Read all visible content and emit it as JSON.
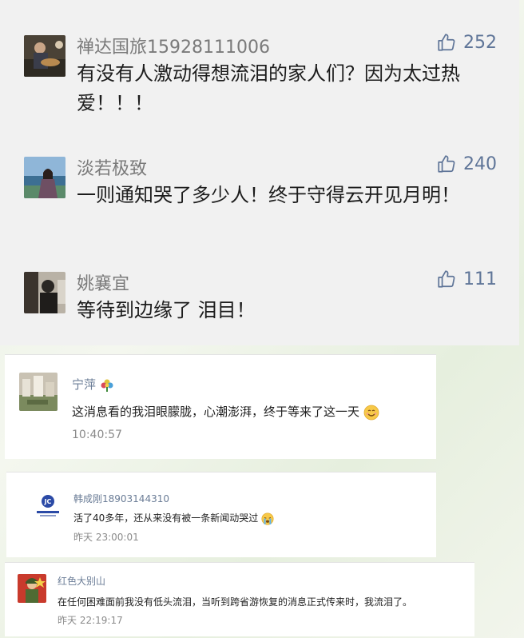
{
  "comments": [
    {
      "user": "禅达国旅15928111006",
      "likes": "252",
      "text": "有没有人激动得想流泪的家人们？因为太过热爱！！！",
      "avatar": "guitar-player-photo"
    },
    {
      "user": "淡若极致",
      "likes": "240",
      "text": "一则通知哭了多少人！终于守得云开见月明！",
      "avatar": "lakeside-woman-photo"
    },
    {
      "user": "姚襄宜",
      "likes": "111",
      "text": "等待到边缘了 泪目！",
      "avatar": "silhouette-photo"
    }
  ],
  "posts": [
    {
      "user": "宁萍",
      "badge_icon": "flower-icon",
      "text": "这消息看的我泪眼朦胧，心潮澎湃，终于等来了这一天",
      "emoji": "smile-emoji",
      "time": "10:40:57",
      "avatar": "town-photo"
    },
    {
      "user": "韩成刚18903144310",
      "text": "活了40多年，还从来没有被一条新闻动哭过",
      "emoji": "crying-emoji",
      "time": "昨天 23:00:01",
      "avatar": "jc-logo"
    },
    {
      "user": "红色大别山",
      "text": "在任何困难面前我没有低头流泪，当听到跨省游恢复的消息正式传来时，我流泪了。",
      "time": "昨天 22:19:17",
      "avatar": "soldier-photo"
    }
  ],
  "colors": {
    "name": "#7a7a7a",
    "like": "#5f7598",
    "card_bg": "#f1f1f1",
    "post_name": "#6a7c96"
  }
}
